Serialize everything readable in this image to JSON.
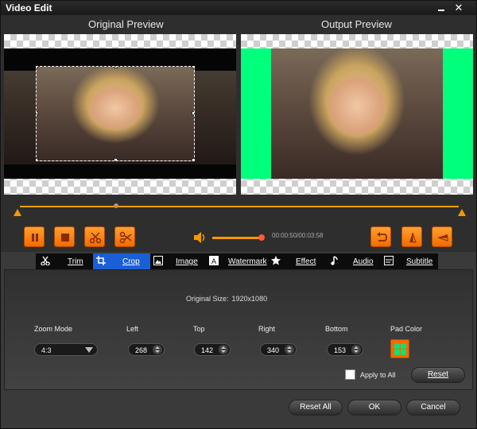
{
  "window": {
    "title": "Video Edit"
  },
  "preview": {
    "original_label": "Original Preview",
    "output_label": "Output Preview"
  },
  "player": {
    "time": "00:00:50/00:03:58",
    "pad_color": "#00ff7a",
    "accent": "#f26b00"
  },
  "tabs": [
    {
      "label": "Trim",
      "icon": "scissors-icon",
      "active": false
    },
    {
      "label": "Crop",
      "icon": "crop-icon",
      "active": true
    },
    {
      "label": "Image",
      "icon": "image-icon",
      "active": false
    },
    {
      "label": "Watermark",
      "icon": "watermark-icon",
      "active": false
    },
    {
      "label": "Effect",
      "icon": "star-icon",
      "active": false
    },
    {
      "label": "Audio",
      "icon": "music-note-icon",
      "active": false
    },
    {
      "label": "Subtitle",
      "icon": "subtitle-icon",
      "active": false
    }
  ],
  "crop": {
    "original_size_label": "Original Size:",
    "original_size_value": "1920x1080",
    "zoom_mode_label": "Zoom Mode",
    "zoom_mode_value": "4:3",
    "left_label": "Left",
    "left_value": "268",
    "top_label": "Top",
    "top_value": "142",
    "right_label": "Right",
    "right_value": "340",
    "bottom_label": "Bottom",
    "bottom_value": "153",
    "pad_color_label": "Pad Color",
    "apply_all_label": "Apply to All",
    "reset_label": "Reset"
  },
  "footer": {
    "reset_all": "Reset All",
    "ok": "OK",
    "cancel": "Cancel"
  }
}
